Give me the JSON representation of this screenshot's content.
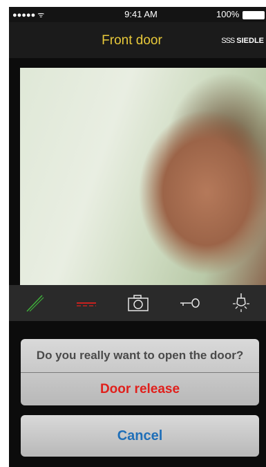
{
  "status_bar": {
    "signal": "●●●●● ᯤ",
    "time": "9:41 AM",
    "battery": "100%"
  },
  "header": {
    "title": "Front door",
    "brand_mark": "SSS",
    "brand": "SIEDLE"
  },
  "video_feed": {
    "description_icon": "camera-video"
  },
  "toolbar": {
    "icons": [
      "phone-answer-icon",
      "phone-hangup-icon",
      "camera-icon",
      "key-icon",
      "light-icon"
    ],
    "colors": {
      "answer": "#3fae3b",
      "hangup": "#e0201c",
      "neutral": "#e6e6e6"
    }
  },
  "dialog": {
    "question": "Do you really want to open the door?",
    "confirm_label": "Door release",
    "cancel_label": "Cancel",
    "confirm_color": "#e0201c",
    "cancel_color": "#1f6fb8"
  }
}
